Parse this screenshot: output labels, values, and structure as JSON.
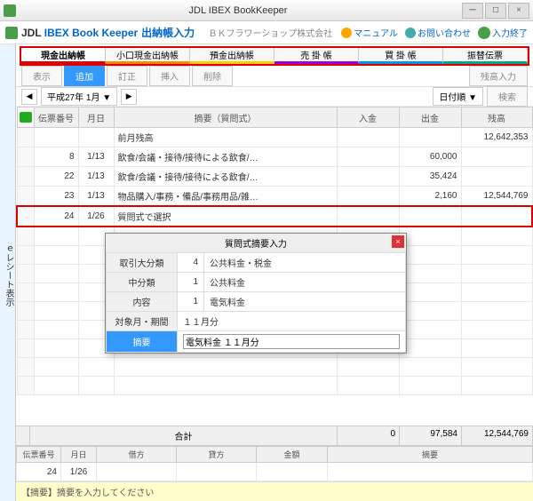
{
  "window": {
    "title": "JDL IBEX BookKeeper"
  },
  "app": {
    "brand_prefix": "JDL",
    "brand_blue": "IBEX Book Keeper",
    "subtitle": "出納帳入力",
    "company": "ＢＫフラワーショップ株式会社",
    "links": {
      "manual": "マニュアル",
      "contact": "お問い合わせ",
      "exit": "入力終了"
    }
  },
  "sidetab": "ｅレシート表示",
  "tabs": [
    "現金出納帳",
    "小口現金出納帳",
    "預金出納帳",
    "売 掛 帳",
    "買 掛 帳",
    "振替伝票"
  ],
  "toolbar": {
    "view": "表示",
    "add": "追加",
    "edit": "訂正",
    "insert": "挿入",
    "delete": "削除",
    "balance": "残高入力"
  },
  "date": {
    "period": "平成27年 1月",
    "sort": "日付順",
    "search": "検索"
  },
  "columns": {
    "no": "伝票番号",
    "date": "月日",
    "desc": "摘要（質問式）",
    "in": "入金",
    "out": "出金",
    "bal": "残高"
  },
  "rows": [
    {
      "no": "",
      "date": "",
      "desc": "前月残高",
      "in": "",
      "out": "",
      "bal": "12,642,353"
    },
    {
      "no": "8",
      "date": "1/13",
      "desc": "飲食/会議・接待/接待による飲食/…",
      "in": "",
      "out": "60,000",
      "bal": ""
    },
    {
      "no": "22",
      "date": "1/13",
      "desc": "飲食/会議・接待/接待による飲食/…",
      "in": "",
      "out": "35,424",
      "bal": ""
    },
    {
      "no": "23",
      "date": "1/13",
      "desc": "物品購入/事務・備品/事務用品/雑…",
      "in": "",
      "out": "2,160",
      "bal": "12,544,769"
    },
    {
      "no": "24",
      "date": "1/26",
      "desc": "質問式で選択",
      "in": "",
      "out": "",
      "bal": ""
    }
  ],
  "total": {
    "label": "合計",
    "in": "0",
    "out": "97,584",
    "bal": "12,544,769"
  },
  "bottom": {
    "cols": {
      "no": "伝票番号",
      "date": "月日",
      "debit": "借方",
      "credit": "貸方",
      "amount": "金額",
      "desc": "摘要"
    },
    "row": {
      "no": "24",
      "date": "1/26"
    }
  },
  "hint": "【摘要】摘要を入力してください",
  "modal": {
    "title": "質問式摘要入力",
    "fields": {
      "cat1_lbl": "取引大分類",
      "cat1_no": "4",
      "cat1_val": "公共料金・税金",
      "cat2_lbl": "中分類",
      "cat2_no": "1",
      "cat2_val": "公共料金",
      "cat3_lbl": "内容",
      "cat3_no": "1",
      "cat3_val": "電気料金",
      "period_lbl": "対象月・期間",
      "period_val": "１１月分",
      "desc_lbl": "摘要",
      "desc_val": "電気料金 １１月分"
    }
  }
}
